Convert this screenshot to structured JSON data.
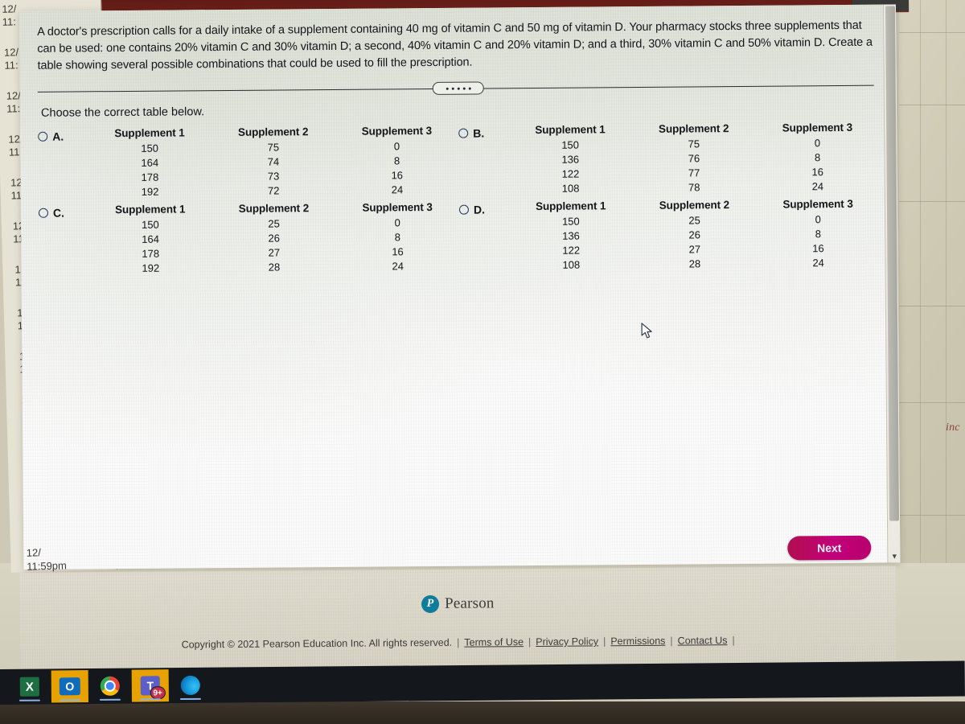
{
  "question": {
    "stem": "A doctor's prescription calls for a daily intake of a supplement containing 40 mg of vitamin C and 50 mg of vitamin D. Your pharmacy stocks three supplements that can be used: one contains 20% vitamin C and 30% vitamin D; a second, 40% vitamin C and 20% vitamin D; and a third, 30% vitamin C and 50% vitamin D. Create a table showing several possible combinations that could be used to fill the prescription.",
    "instruction": "Choose the correct table below."
  },
  "options": [
    {
      "letter": "A.",
      "selected": false,
      "headers": [
        "Supplement 1",
        "Supplement 2",
        "Supplement 3"
      ],
      "rows": [
        [
          "150",
          "75",
          "0"
        ],
        [
          "164",
          "74",
          "8"
        ],
        [
          "178",
          "73",
          "16"
        ],
        [
          "192",
          "72",
          "24"
        ]
      ]
    },
    {
      "letter": "B.",
      "selected": false,
      "headers": [
        "Supplement 1",
        "Supplement 2",
        "Supplement 3"
      ],
      "rows": [
        [
          "150",
          "75",
          "0"
        ],
        [
          "136",
          "76",
          "8"
        ],
        [
          "122",
          "77",
          "16"
        ],
        [
          "108",
          "78",
          "24"
        ]
      ]
    },
    {
      "letter": "C.",
      "selected": false,
      "headers": [
        "Supplement 1",
        "Supplement 2",
        "Supplement 3"
      ],
      "rows": [
        [
          "150",
          "25",
          "0"
        ],
        [
          "164",
          "26",
          "8"
        ],
        [
          "178",
          "27",
          "16"
        ],
        [
          "192",
          "28",
          "24"
        ]
      ]
    },
    {
      "letter": "D.",
      "selected": false,
      "headers": [
        "Supplement 1",
        "Supplement 2",
        "Supplement 3"
      ],
      "rows": [
        [
          "150",
          "25",
          "0"
        ],
        [
          "136",
          "26",
          "8"
        ],
        [
          "122",
          "27",
          "16"
        ],
        [
          "108",
          "28",
          "24"
        ]
      ]
    }
  ],
  "actions": {
    "next_label": "Next"
  },
  "footer": {
    "brand_mark": "P",
    "brand_name": "Pearson",
    "copyright": "Copyright © 2021 Pearson Education Inc. All rights reserved.",
    "links": [
      "Terms of Use",
      "Privacy Policy",
      "Permissions",
      "Contact Us"
    ],
    "separator": "|"
  },
  "background": {
    "partial_text": "inc",
    "bottom_stamp_date": "12/",
    "bottom_stamp_time": "11:59pm",
    "window_stamp_date": "12/",
    "window_stamp_time": "11:"
  },
  "taskbar": {
    "items": [
      {
        "name": "excel",
        "glyph": "X",
        "active": false
      },
      {
        "name": "outlook",
        "glyph": "O",
        "active": true
      },
      {
        "name": "chrome",
        "glyph": "",
        "active": false
      },
      {
        "name": "teams",
        "glyph": "T",
        "badge": "9+",
        "active": true
      },
      {
        "name": "edge",
        "glyph": "",
        "active": false
      }
    ]
  },
  "colors": {
    "next_button": "#c3007a",
    "radio_border": "#1f3864",
    "pearson_blue": "#0f7c9c",
    "top_band": "#6d201a"
  }
}
